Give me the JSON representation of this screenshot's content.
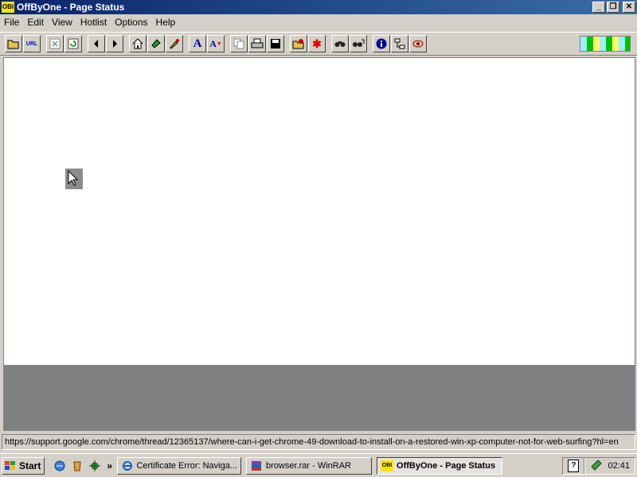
{
  "window": {
    "icon_text": "OBI",
    "title": "OffByOne - Page Status",
    "minimize": "_",
    "restore": "❐",
    "close": "✕"
  },
  "menu": [
    "File",
    "Edit",
    "View",
    "Hotlist",
    "Options",
    "Help"
  ],
  "toolbar": {
    "icons": [
      "open-folder-icon",
      "url-icon",
      "stop-icon",
      "refresh-icon",
      "back-icon",
      "forward-icon",
      "home-icon",
      "bookmark-icon",
      "brush-icon",
      "font-increase-icon",
      "font-decrease-icon",
      "copy-icon",
      "print-icon",
      "save-icon",
      "folder-settings-icon",
      "gear-red-icon",
      "find-icon",
      "find-next-icon",
      "info-icon",
      "sitemap-icon",
      "eye-icon"
    ],
    "url_label": "URL"
  },
  "status_text": "https://support.google.com/chrome/thread/12365137/where-can-i-get-chrome-49-download-to-install-on-a-restored-win-xp-computer-not-for-web-surfing?hl=en",
  "taskbar": {
    "start_label": "Start",
    "tasks": [
      {
        "label": "Certificate Error: Naviga...",
        "icon": "ie-icon",
        "active": false
      },
      {
        "label": "browser.rar - WinRAR",
        "icon": "winrar-icon",
        "active": false
      },
      {
        "label": "OffByOne - Page Status",
        "icon": "offbyone-icon",
        "icon_text": "OBI",
        "active": true
      }
    ],
    "quicklaunch_more": "»",
    "clock": "02:41"
  },
  "colors": {
    "titlebar_start": "#0a246a",
    "titlebar_end": "#3a6ea5",
    "face": "#d4d0c8",
    "content_gray": "#808080"
  }
}
